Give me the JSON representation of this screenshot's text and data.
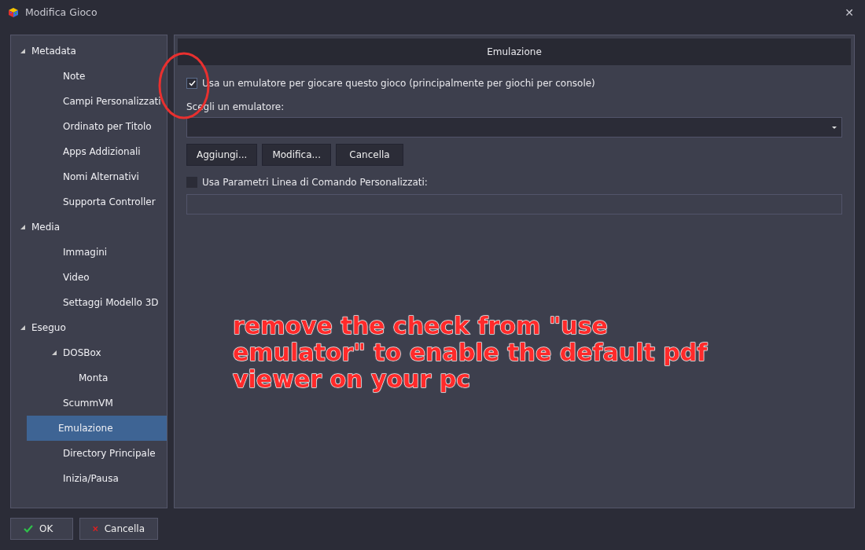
{
  "window": {
    "title": "Modifica Gioco",
    "close": "✕"
  },
  "sidebar": {
    "items": [
      {
        "label": "Metadata",
        "expanded": true,
        "selected": false,
        "children": [
          {
            "label": "Note",
            "selected": false
          },
          {
            "label": "Campi Personalizzati",
            "selected": false
          },
          {
            "label": "Ordinato per Titolo",
            "selected": false
          },
          {
            "label": "Apps Addizionali",
            "selected": false
          },
          {
            "label": "Nomi Alternativi",
            "selected": false
          },
          {
            "label": "Supporta Controller",
            "selected": false
          }
        ]
      },
      {
        "label": "Media",
        "expanded": true,
        "selected": false,
        "children": [
          {
            "label": "Immagini",
            "selected": false
          },
          {
            "label": "Video",
            "selected": false
          },
          {
            "label": "Settaggi Modello 3D",
            "selected": false
          }
        ]
      },
      {
        "label": "Eseguo",
        "expanded": true,
        "selected": false,
        "children": [
          {
            "label": "DOSBox",
            "expanded": true,
            "selected": false,
            "children": [
              {
                "label": "Monta",
                "selected": false
              }
            ]
          },
          {
            "label": "ScummVM",
            "selected": false
          },
          {
            "label": "Emulazione",
            "selected": true
          },
          {
            "label": "Directory Principale",
            "selected": false
          },
          {
            "label": "Inizia/Pausa",
            "selected": false
          }
        ]
      }
    ]
  },
  "panel": {
    "header": "Emulazione",
    "use_emulator": {
      "label": "Usa un emulatore per giocare questo gioco (principalmente per giochi per console)",
      "checked": true
    },
    "emulator_label": "Scegli un emulatore:",
    "buttons": [
      "Aggiungi...",
      "Modifica...",
      "Cancella"
    ],
    "custom_params": {
      "label": "Usa Parametri Linea di Comando Personalizzati:",
      "checked": false
    }
  },
  "annotation": {
    "lines": [
      "remove the check from \"use",
      "emulator\" to enable the default pdf",
      "viewer on your pc"
    ]
  },
  "footer": {
    "buttons": [
      {
        "kind": "ok",
        "label": "OK"
      },
      {
        "kind": "cancel",
        "label": "Cancella"
      }
    ]
  }
}
